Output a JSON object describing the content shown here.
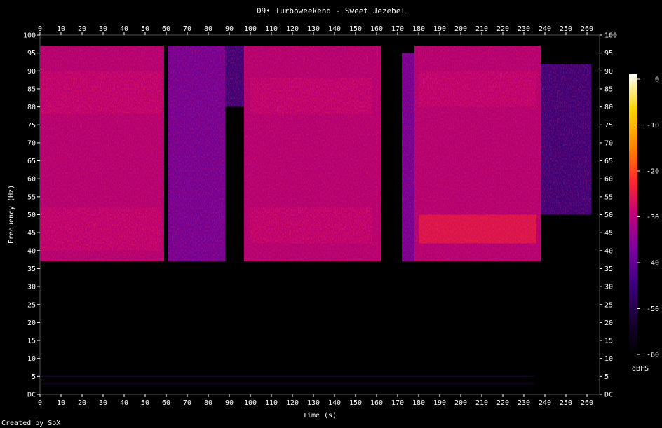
{
  "chart_data": {
    "type": "heatmap",
    "title": "09• Turboweekend - Sweet Jezebel",
    "xlabel": "Time (s)",
    "ylabel": "Frequency (Hz)",
    "colorbar_label": "dBFS",
    "credit": "Created by SoX",
    "xlim": [
      0,
      266
    ],
    "ylim": [
      0,
      100
    ],
    "x_ticks": [
      0,
      10,
      20,
      30,
      40,
      50,
      60,
      70,
      80,
      90,
      100,
      110,
      120,
      130,
      140,
      150,
      160,
      170,
      180,
      190,
      200,
      210,
      220,
      230,
      240,
      250,
      260
    ],
    "y_ticks": [
      "DC",
      "5",
      "10",
      "15",
      "20",
      "25",
      "30",
      "35",
      "40",
      "45",
      "50",
      "55",
      "60",
      "65",
      "70",
      "75",
      "80",
      "85",
      "90",
      "95",
      "100"
    ],
    "colorbar_ticks": [
      "0",
      "-10",
      "-20",
      "-30",
      "-40",
      "-50",
      "-60"
    ],
    "color_scale": [
      "#000000",
      "#1a0033",
      "#3d0080",
      "#7a00a0",
      "#c0007a",
      "#ff2a2a",
      "#ff8c00",
      "#ffd700",
      "#ffffff"
    ],
    "energy_bands": [
      {
        "t_start": 0,
        "t_end": 59,
        "f_low": 37,
        "f_high": 97,
        "level_dbfs": -33
      },
      {
        "t_start": 61,
        "t_end": 88,
        "f_low": 37,
        "f_high": 97,
        "level_dbfs": -34
      },
      {
        "t_start": 88,
        "t_end": 97,
        "f_low": 80,
        "f_high": 97,
        "level_dbfs": -42
      },
      {
        "t_start": 97,
        "t_end": 162,
        "f_low": 37,
        "f_high": 97,
        "level_dbfs": -33
      },
      {
        "t_start": 172,
        "t_end": 178,
        "f_low": 37,
        "f_high": 95,
        "level_dbfs": -36
      },
      {
        "t_start": 178,
        "t_end": 238,
        "f_low": 37,
        "f_high": 97,
        "level_dbfs": -31
      },
      {
        "t_start": 238,
        "t_end": 262,
        "f_low": 50,
        "f_high": 92,
        "level_dbfs": -45
      }
    ],
    "hot_regions": [
      {
        "t_start": 0,
        "t_end": 58,
        "f_low": 40,
        "f_high": 52,
        "level_dbfs": -28
      },
      {
        "t_start": 0,
        "t_end": 58,
        "f_low": 78,
        "f_high": 90,
        "level_dbfs": -29
      },
      {
        "t_start": 100,
        "t_end": 158,
        "f_low": 42,
        "f_high": 52,
        "level_dbfs": -29
      },
      {
        "t_start": 100,
        "t_end": 158,
        "f_low": 78,
        "f_high": 88,
        "level_dbfs": -30
      },
      {
        "t_start": 180,
        "t_end": 236,
        "f_low": 42,
        "f_high": 50,
        "level_dbfs": -26
      },
      {
        "t_start": 180,
        "t_end": 236,
        "f_low": 80,
        "f_high": 90,
        "level_dbfs": -27
      }
    ],
    "low_freq_lines": [
      {
        "t_start": 0,
        "t_end": 235,
        "freq": 5,
        "level_dbfs": -50
      },
      {
        "t_start": 0,
        "t_end": 235,
        "freq": 3,
        "level_dbfs": -52
      }
    ]
  }
}
